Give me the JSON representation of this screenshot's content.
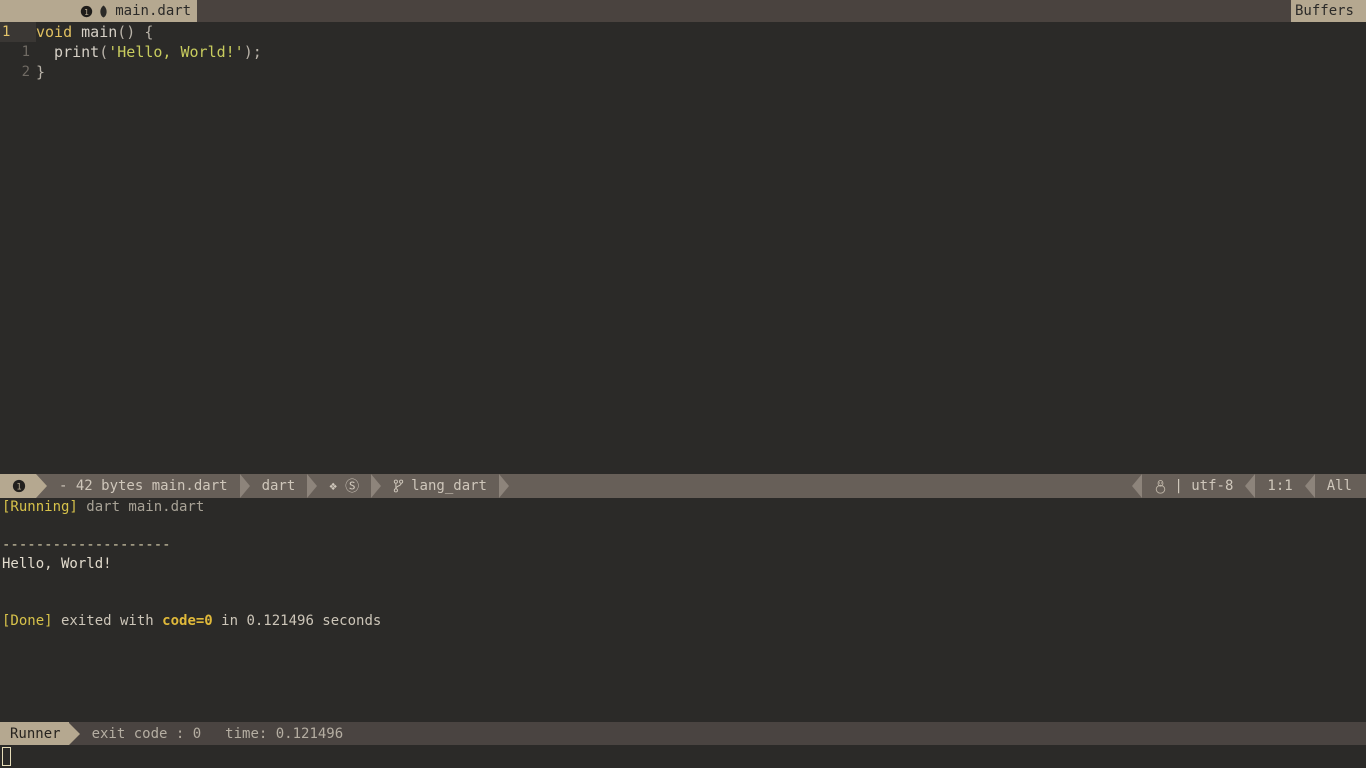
{
  "tabbar": {
    "tab": {
      "number": "1",
      "icon": "dart-icon",
      "label": "main.dart"
    },
    "buffers_label": "Buffers"
  },
  "editor": {
    "lines": [
      {
        "gutter": "1",
        "current": true,
        "tokens": [
          {
            "text": "void",
            "cls": "tok-kw"
          },
          {
            "text": " ",
            "cls": "tok-punc"
          },
          {
            "text": "main",
            "cls": "tok-id"
          },
          {
            "text": "() {",
            "cls": "tok-punc"
          }
        ]
      },
      {
        "gutter": "1",
        "current": false,
        "tokens": [
          {
            "text": "  print",
            "cls": "tok-id"
          },
          {
            "text": "(",
            "cls": "tok-punc"
          },
          {
            "text": "'Hello, World!'",
            "cls": "tok-str"
          },
          {
            "text": ");",
            "cls": "tok-punc"
          }
        ]
      },
      {
        "gutter": "2",
        "current": false,
        "tokens": [
          {
            "text": "}",
            "cls": "tok-punc"
          }
        ]
      }
    ]
  },
  "statusline": {
    "mode_indicator": "1",
    "file_info": "- 42 bytes main.dart",
    "filetype": "dart",
    "diagnostics_icons": [
      {
        "name": "diamond-icon",
        "glyph": "❖"
      },
      {
        "name": "circled-s-icon",
        "glyph": "Ⓢ"
      }
    ],
    "git_icon": "git-branch-icon",
    "git_branch": "lang_dart",
    "os_icon": "linux-penguin-icon",
    "encoding": "| utf-8",
    "position": "1:1",
    "scroll": "All"
  },
  "terminal": {
    "lines": [
      {
        "spans": [
          {
            "text": "[Running]",
            "cls": "t-running"
          },
          {
            "text": " dart main.dart",
            "cls": "t-cmd"
          }
        ]
      },
      {
        "spans": [
          {
            "text": "",
            "cls": "t-plain"
          }
        ]
      },
      {
        "spans": [
          {
            "text": "--------------------",
            "cls": "t-rule"
          }
        ]
      },
      {
        "spans": [
          {
            "text": "Hello, World!",
            "cls": "t-out"
          }
        ]
      },
      {
        "spans": [
          {
            "text": "",
            "cls": "t-plain"
          }
        ]
      },
      {
        "spans": [
          {
            "text": "",
            "cls": "t-plain"
          }
        ]
      },
      {
        "spans": [
          {
            "text": "[Done]",
            "cls": "t-done"
          },
          {
            "text": " exited with ",
            "cls": "t-plain"
          },
          {
            "text": "code=0",
            "cls": "t-code"
          },
          {
            "text": " in 0.121496 seconds",
            "cls": "t-plain"
          }
        ]
      }
    ]
  },
  "runnerbar": {
    "tag": "Runner",
    "exit_code_text": "exit code : 0",
    "time_text": "time: 0.121496"
  },
  "colors": {
    "editor_bg": "#2b2a28",
    "tabbar_bg": "#4a433f",
    "accent_tan": "#b5a890",
    "statusline_bg": "#675f58",
    "keyword_yellow": "#e0c060",
    "string_olive": "#c8cc5e",
    "running_yellow": "#d7c24a",
    "code_gold": "#e0b93a",
    "cursor_outline": "#e6dcb8"
  }
}
